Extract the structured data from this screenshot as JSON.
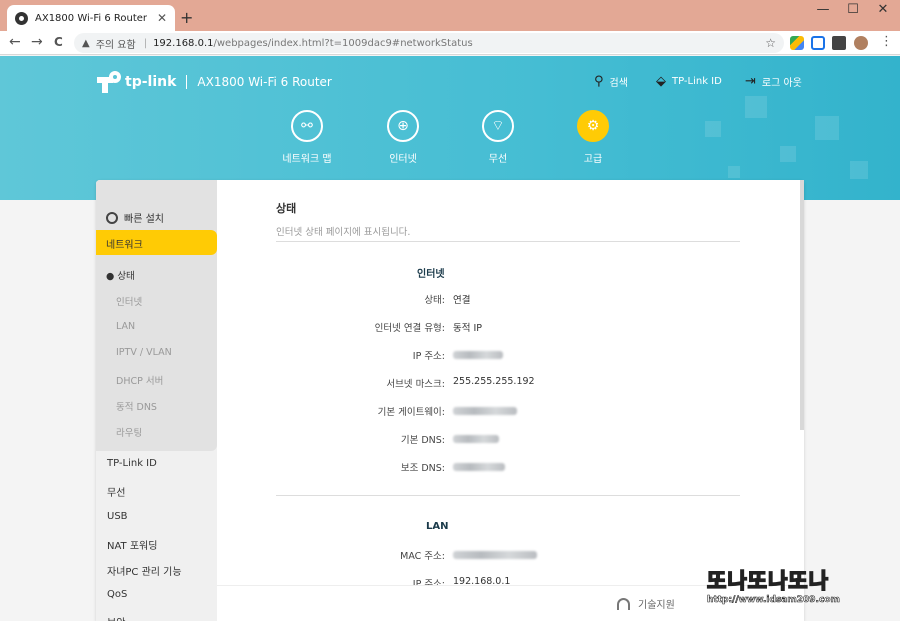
{
  "browser": {
    "tab_title": "AX1800 Wi-Fi 6 Router",
    "tab_close": "✕",
    "new_tab": "+",
    "window_controls": [
      "—",
      "☐",
      "✕"
    ],
    "nav_back": "←",
    "nav_forward": "→",
    "nav_reload": "C",
    "security_label": "주의 요함",
    "url_host": "192.168.0.1",
    "url_path": "/webpages/index.html?t=1009dac9#networkStatus",
    "bookmark_icon": "star-icon",
    "menu": "⋮"
  },
  "header": {
    "brand": "tp-link",
    "model": "AX1800 Wi-Fi 6 Router",
    "search": "검색",
    "tplink_id": "TP-Link ID",
    "logout": "로그 아웃",
    "nav": [
      {
        "label": "네트워크 맵",
        "icon": "network-map-icon"
      },
      {
        "label": "인터넷",
        "icon": "globe-icon"
      },
      {
        "label": "무선",
        "icon": "wifi-icon"
      },
      {
        "label": "고급",
        "icon": "gear-icon"
      }
    ],
    "accent": "#ffcb05",
    "bg": "#45bdd3"
  },
  "sidebar": {
    "quick_setup": "빠른 설치",
    "active_section": "네트워크",
    "sub_items": [
      "상태",
      "인터넷",
      "LAN",
      "IPTV / VLAN",
      "DHCP 서버",
      "동적 DNS",
      "라우팅"
    ],
    "main_items": [
      "TP-Link ID",
      "무선",
      "USB",
      "NAT 포워딩",
      "자녀PC 관리 기능",
      "QoS",
      "보안"
    ]
  },
  "content": {
    "title": "상태",
    "description": "인터넷 상태 페이지에 표시됩니다.",
    "internet_group": "인터넷",
    "internet_rows": [
      {
        "key": "상태:",
        "value": "연결",
        "blurred": false
      },
      {
        "key": "인터넷 연결 유형:",
        "value": "동적 IP",
        "blurred": false
      },
      {
        "key": "IP 주소:",
        "value": "",
        "blurred": true
      },
      {
        "key": "서브넷 마스크:",
        "value": "255.255.255.192",
        "blurred": false
      },
      {
        "key": "기본 게이트웨이:",
        "value": "",
        "blurred": true
      },
      {
        "key": "기본 DNS:",
        "value": "",
        "blurred": true
      },
      {
        "key": "보조 DNS:",
        "value": "",
        "blurred": true
      }
    ],
    "lan_group": "LAN",
    "lan_rows": [
      {
        "key": "MAC 주소:",
        "value": "",
        "blurred": true
      },
      {
        "key": "IP 주소:",
        "value": "192.168.0.1",
        "blurred": false
      }
    ]
  },
  "footer": {
    "support": "기술지원"
  },
  "watermark": {
    "text": "또나또나또나",
    "url": "http://www.idsam209.com"
  }
}
